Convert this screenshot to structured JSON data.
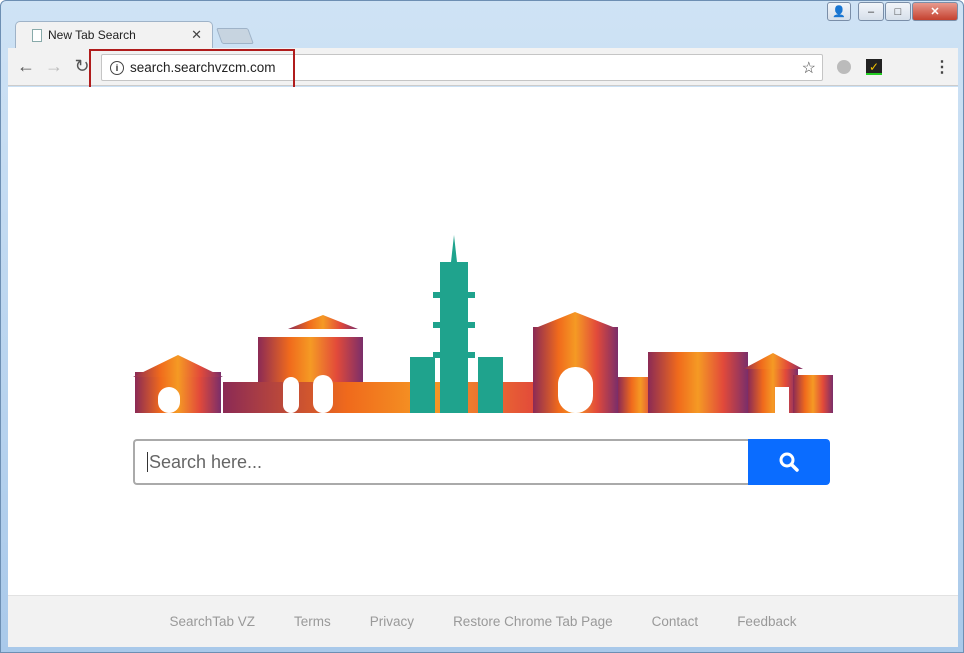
{
  "browser": {
    "tab_title": "New Tab Search",
    "url": "search.searchvzcm.com"
  },
  "search": {
    "placeholder": "Search here..."
  },
  "footer": {
    "links": [
      "SearchTab VZ",
      "Terms",
      "Privacy",
      "Restore Chrome Tab Page",
      "Contact",
      "Feedback"
    ]
  },
  "colors": {
    "accent": "#0a6cff",
    "highlight": "#b01c1c"
  }
}
